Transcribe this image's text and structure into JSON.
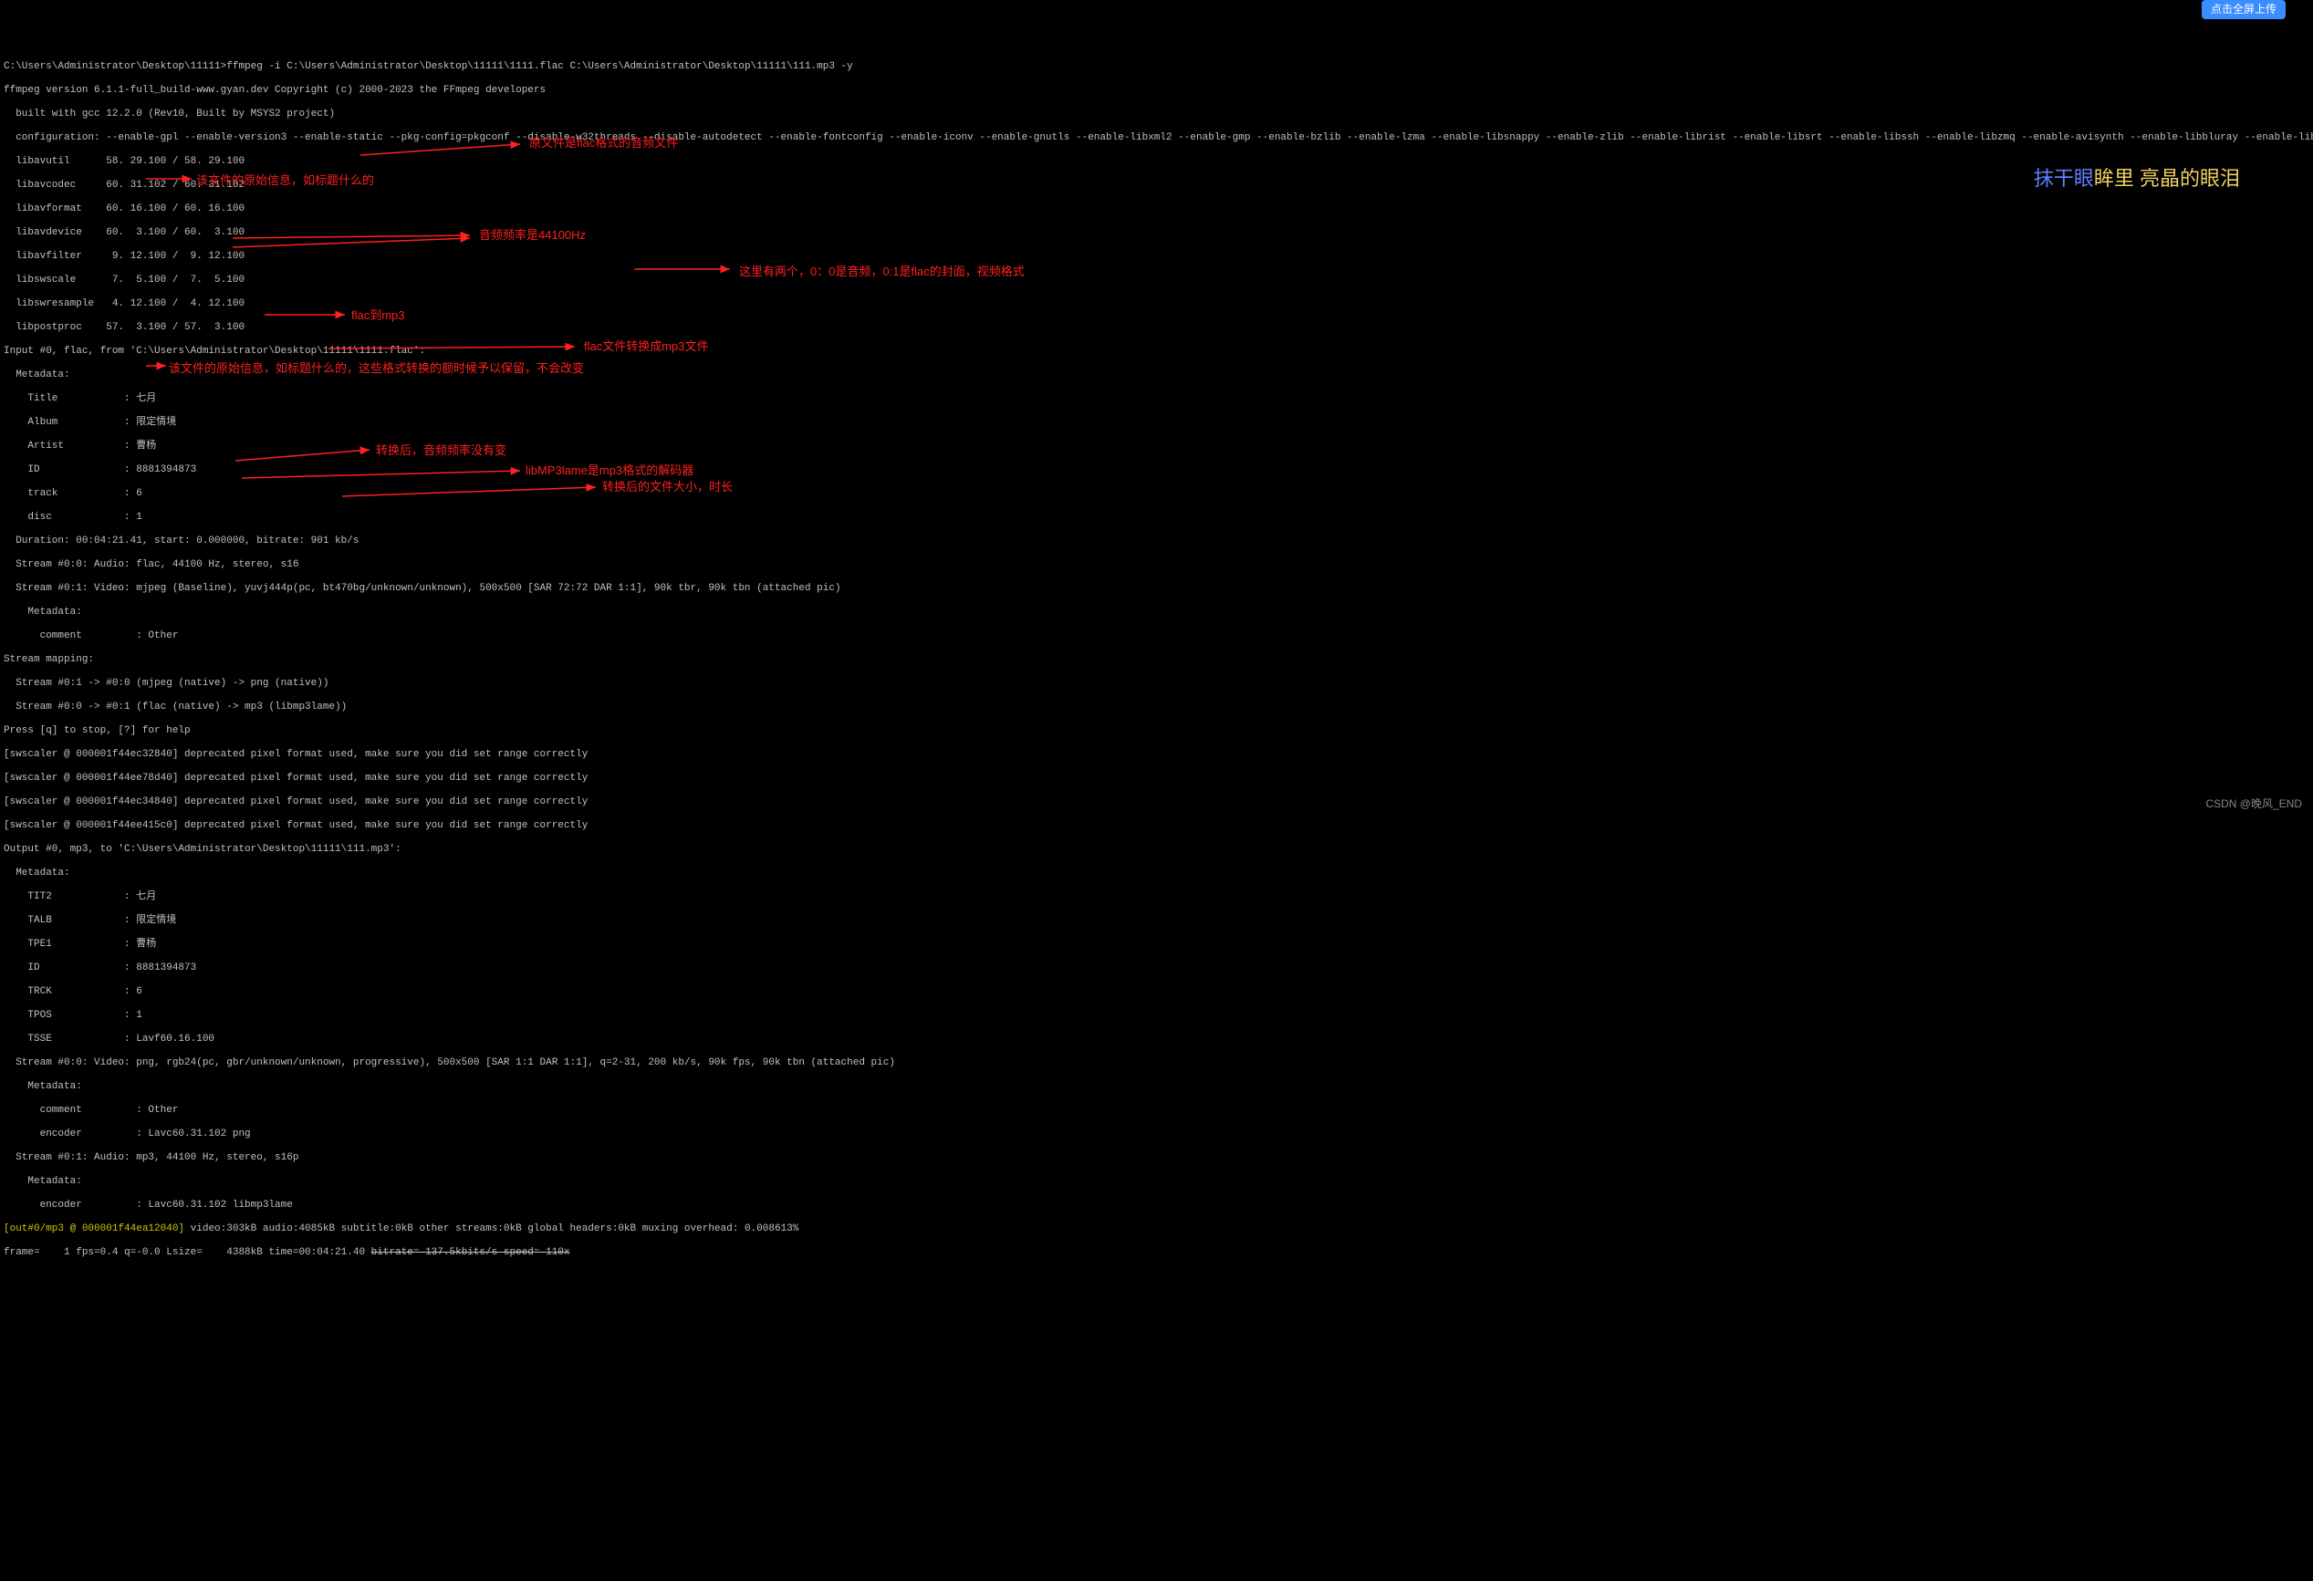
{
  "cmd_prompt": "C:\\Users\\Administrator\\Desktop\\11111>",
  "cmd_line": "ffmpeg -i C:\\Users\\Administrator\\Desktop\\11111\\1111.flac C:\\Users\\Administrator\\Desktop\\11111\\111.mp3 -y",
  "version": "ffmpeg version 6.1.1-full_build-www.gyan.dev Copyright (c) 2000-2023 the FFmpeg developers",
  "built": "  built with gcc 12.2.0 (Rev10, Built by MSYS2 project)",
  "config": "  configuration: --enable-gpl --enable-version3 --enable-static --pkg-config=pkgconf --disable-w32threads --disable-autodetect --enable-fontconfig --enable-iconv --enable-gnutls --enable-libxml2 --enable-gmp --enable-bzlib --enable-lzma --enable-libsnappy --enable-zlib --enable-librist --enable-libsrt --enable-libssh --enable-libzmq --enable-avisynth --enable-libbluray --enable-libcaca --enable-sdl2 --enable-libaribb24 --enable-libaribcaption --enable-libdav1d --enable-libdavs2 --enable-libuavs3d --enable-libzvbi --enable-librav1e --enable-libsvtav1 --enable-libwebp --enable-libx264 --enable-libx265 --enable-libxavs2 --enable-libxvid --enable-libaom --enable-libjxl --enable-libopenjpeg --enable-libvpx --enable-mediafoundation --enable-libass --enable-frei0r --enable-libfreetype --enable-libfribidi --enable-libharfbuzz --enable-liblensfun --enable-libvidstab --enable-libvmaf --enable-libzimg --enable-amf --enable-cuda-llvm --enable-cuvid --enable-ffnvcodec --enable-nvdec --enable-nvenc --enable-dxva2 --enable-d3d11va --enable-libvpl --enable-libshaderc --enable-vulkan --enable-libplacebo --enable-opencl --enable-libcdio --enable-libgme --enable-libmodplug --enable-libopenmpt --enable-libopencore-amrwb --enable-libmp3lame --enable-libshine --enable-libtheora --enable-libtwolame --enable-libvo-amrwbenc --enable-libcodec2 --enable-libilbc --enable-libgsm --enable-libopencore-amrnb --enable-libopus --enable-libspeex --enable-libvorbis --enable-ladspa --enable-libbs2b --enable-libflite --enable-libmysofa --enable-librubberband --enable-libsoxr --enable-chromaprint",
  "libs": [
    "  libavutil      58. 29.100 / 58. 29.100",
    "  libavcodec     60. 31.102 / 60. 31.102",
    "  libavformat    60. 16.100 / 60. 16.100",
    "  libavdevice    60.  3.100 / 60.  3.100",
    "  libavfilter     9. 12.100 /  9. 12.100",
    "  libswscale      7.  5.100 /  7.  5.100",
    "  libswresample   4. 12.100 /  4. 12.100",
    "  libpostproc    57.  3.100 / 57.  3.100"
  ],
  "input_head": "Input #0, flac, from 'C:\\Users\\Administrator\\Desktop\\11111\\1111.flac':",
  "meta_in": [
    "  Metadata:",
    "    Title           : 七月",
    "    Album           : 限定情境",
    "    Artist          : 曹杨",
    "    ID              : 8881394873",
    "    track           : 6",
    "    disc            : 1"
  ],
  "duration": "  Duration: 00:04:21.41, start: 0.000000, bitrate: 901 kb/s",
  "stream_a": "  Stream #0:0: Audio: flac, 44100 Hz, stereo, s16",
  "stream_v": "  Stream #0:1: Video: mjpeg (Baseline), yuvj444p(pc, bt470bg/unknown/unknown), 500x500 [SAR 72:72 DAR 1:1], 90k tbr, 90k tbn (attached pic)",
  "meta_v": [
    "    Metadata:",
    "      comment         : Other"
  ],
  "mapping": [
    "Stream mapping:",
    "  Stream #0:1 -> #0:0 (mjpeg (native) -> png (native))",
    "  Stream #0:0 -> #0:1 (flac (native) -> mp3 (libmp3lame))"
  ],
  "press": "Press [q] to stop, [?] for help",
  "swscaler": [
    "[swscaler @ 000001f44ec32840] deprecated pixel format used, make sure you did set range correctly",
    "[swscaler @ 000001f44ee78d40] deprecated pixel format used, make sure you did set range correctly",
    "[swscaler @ 000001f44ec34840] deprecated pixel format used, make sure you did set range correctly",
    "[swscaler @ 000001f44ee415c0] deprecated pixel format used, make sure you did set range correctly"
  ],
  "output_head": "Output #0, mp3, to 'C:\\Users\\Administrator\\Desktop\\11111\\111.mp3':",
  "meta_out": [
    "  Metadata:",
    "    TIT2            : 七月",
    "    TALB            : 限定情境",
    "    TPE1            : 曹杨",
    "    ID              : 8881394873",
    "    TRCK            : 6",
    "    TPOS            : 1",
    "    TSSE            : Lavf60.16.100"
  ],
  "out_stream_v": "  Stream #0:0: Video: png, rgb24(pc, gbr/unknown/unknown, progressive), 500x500 [SAR 1:1 DAR 1:1], q=2-31, 200 kb/s, 90k fps, 90k tbn (attached pic)",
  "out_meta_v": [
    "    Metadata:",
    "      comment         : Other",
    "      encoder         : Lavc60.31.102 png"
  ],
  "out_stream_a": "  Stream #0:1: Audio: mp3, 44100 Hz, stereo, s16p",
  "out_meta_a": [
    "    Metadata:",
    "      encoder         : Lavc60.31.102 libmp3lame"
  ],
  "summary_prefix": "[out#0/mp3 @ 000001f44ea12040] ",
  "summary": "video:303kB audio:4085kB subtitle:0kB other streams:0kB global headers:0kB muxing overhead: 0.008613%",
  "frame": "frame=    1 fps=0.4 q=-0.0 Lsize=    4388kB time=00:04:21.40 ",
  "frame_struck": "bitrate= 137.5kbits/s speed= 110x",
  "annotations": {
    "a1": "原文件是flac格式的音频文件",
    "a2": "该文件的原始信息，如标题什么的",
    "a3": "音频频率是44100Hz",
    "a4": "这里有两个，0：0是音频，0:1是flac的封面，视频格式",
    "a5": "flac到mp3",
    "a6": "flac文件转换成mp3文件",
    "a7": "该文件的原始信息，如标题什么的，这些格式转换的额时候予以保留，不会改变",
    "a8": "转换后，音频频率没有变",
    "a9": "libMP3lame是mp3格式的解码器",
    "a10": "转换后的文件大小，时长"
  },
  "lyrics_played": "抹干眼",
  "lyrics_rest": "眸里 亮晶的眼泪",
  "watermark": "CSDN @晚风_END",
  "badge": "点击全屏上传"
}
